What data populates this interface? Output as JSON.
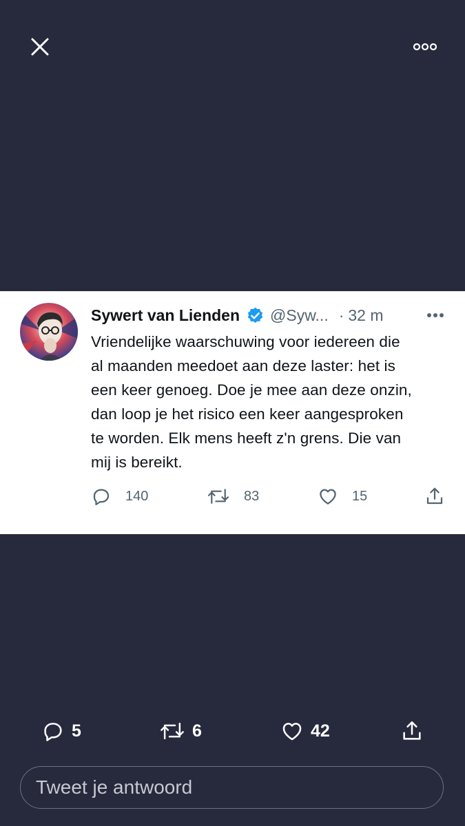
{
  "top_bar": {
    "close_icon": "close-icon",
    "more_icon": "more-horizontal-icon"
  },
  "tweet": {
    "author_name": "Sywert van Lienden",
    "verified": true,
    "handle": "@Syw...",
    "separator": "·",
    "time": "32 m",
    "text": "Vriendelijke waarschuwing voor iedereen die\nal maanden meedoet aan deze laster: het is\neen keer genoeg. Doe je mee aan deze onzin,\ndan loop je het risico een keer aangesproken\nte worden. Elk mens heeft z'n grens. Die van\nmij is bereikt.",
    "replies": "140",
    "retweets": "83",
    "likes": "15"
  },
  "bottom_bar": {
    "replies": "5",
    "retweets": "6",
    "likes": "42"
  },
  "reply_box": {
    "placeholder": "Tweet je antwoord"
  },
  "colors": {
    "background": "#27293d",
    "card": "#ffffff",
    "verified_badge": "#1d9bf0",
    "text_primary": "#0f1419",
    "text_secondary": "#536471"
  }
}
